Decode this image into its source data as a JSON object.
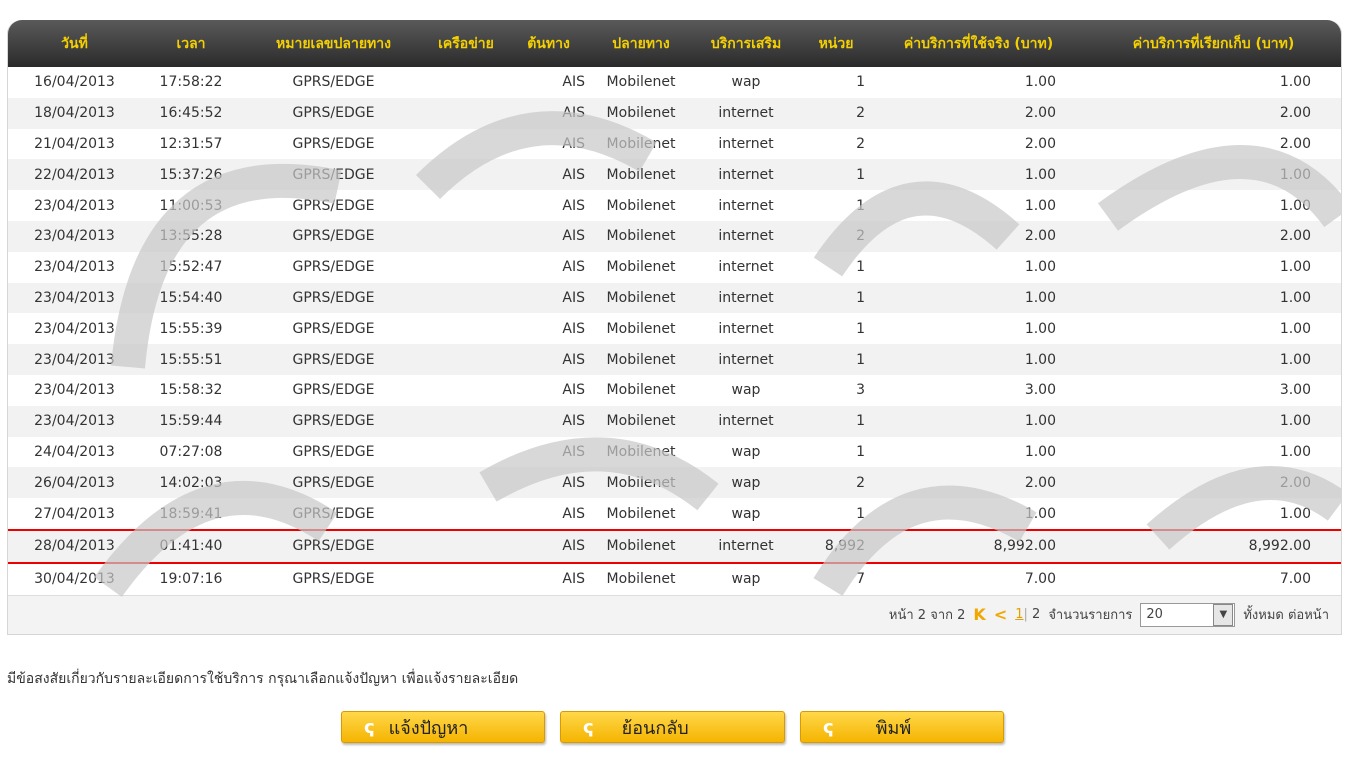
{
  "headers": [
    "วันที่",
    "เวลา",
    "หมายเลขปลายทาง",
    "เครือข่าย",
    "ต้นทาง",
    "ปลายทาง",
    "บริการเสริม",
    "หน่วย",
    "ค่าบริการที่ใช้จริง (บาท)",
    "ค่าบริการที่เรียกเก็บ (บาท)"
  ],
  "rows": [
    [
      "16/04/2013",
      "17:58:22",
      "GPRS/EDGE",
      "",
      "AIS",
      "Mobilenet",
      "wap",
      "1",
      "1.00",
      "1.00"
    ],
    [
      "18/04/2013",
      "16:45:52",
      "GPRS/EDGE",
      "",
      "AIS",
      "Mobilenet",
      "internet",
      "2",
      "2.00",
      "2.00"
    ],
    [
      "21/04/2013",
      "12:31:57",
      "GPRS/EDGE",
      "",
      "AIS",
      "Mobilenet",
      "internet",
      "2",
      "2.00",
      "2.00"
    ],
    [
      "22/04/2013",
      "15:37:26",
      "GPRS/EDGE",
      "",
      "AIS",
      "Mobilenet",
      "internet",
      "1",
      "1.00",
      "1.00"
    ],
    [
      "23/04/2013",
      "11:00:53",
      "GPRS/EDGE",
      "",
      "AIS",
      "Mobilenet",
      "internet",
      "1",
      "1.00",
      "1.00"
    ],
    [
      "23/04/2013",
      "13:55:28",
      "GPRS/EDGE",
      "",
      "AIS",
      "Mobilenet",
      "internet",
      "2",
      "2.00",
      "2.00"
    ],
    [
      "23/04/2013",
      "15:52:47",
      "GPRS/EDGE",
      "",
      "AIS",
      "Mobilenet",
      "internet",
      "1",
      "1.00",
      "1.00"
    ],
    [
      "23/04/2013",
      "15:54:40",
      "GPRS/EDGE",
      "",
      "AIS",
      "Mobilenet",
      "internet",
      "1",
      "1.00",
      "1.00"
    ],
    [
      "23/04/2013",
      "15:55:39",
      "GPRS/EDGE",
      "",
      "AIS",
      "Mobilenet",
      "internet",
      "1",
      "1.00",
      "1.00"
    ],
    [
      "23/04/2013",
      "15:55:51",
      "GPRS/EDGE",
      "",
      "AIS",
      "Mobilenet",
      "internet",
      "1",
      "1.00",
      "1.00"
    ],
    [
      "23/04/2013",
      "15:58:32",
      "GPRS/EDGE",
      "",
      "AIS",
      "Mobilenet",
      "wap",
      "3",
      "3.00",
      "3.00"
    ],
    [
      "23/04/2013",
      "15:59:44",
      "GPRS/EDGE",
      "",
      "AIS",
      "Mobilenet",
      "internet",
      "1",
      "1.00",
      "1.00"
    ],
    [
      "24/04/2013",
      "07:27:08",
      "GPRS/EDGE",
      "",
      "AIS",
      "Mobilenet",
      "wap",
      "1",
      "1.00",
      "1.00"
    ],
    [
      "26/04/2013",
      "14:02:03",
      "GPRS/EDGE",
      "",
      "AIS",
      "Mobilenet",
      "wap",
      "2",
      "2.00",
      "2.00"
    ],
    [
      "27/04/2013",
      "18:59:41",
      "GPRS/EDGE",
      "",
      "AIS",
      "Mobilenet",
      "wap",
      "1",
      "1.00",
      "1.00"
    ],
    [
      "28/04/2013",
      "01:41:40",
      "GPRS/EDGE",
      "",
      "AIS",
      "Mobilenet",
      "internet",
      "8,992",
      "8,992.00",
      "8,992.00"
    ],
    [
      "30/04/2013",
      "19:07:16",
      "GPRS/EDGE",
      "",
      "AIS",
      "Mobilenet",
      "wap",
      "7",
      "7.00",
      "7.00"
    ]
  ],
  "highlighted_row": 15,
  "pager": {
    "page_info": "หน้า 2 จาก 2",
    "first_icon": "K",
    "prev_icon": "<",
    "page1": "1",
    "sep": "|",
    "page2": "2",
    "items_label": "จำนวนรายการ",
    "per_page": "20",
    "suffix": "ทั้งหมด ต่อหน้า"
  },
  "note": "มีข้อสงสัยเกี่ยวกับรายละเอียดการใช้บริการ กรุณาเลือกแจ้งปัญหา เพื่อแจ้งรายละเอียด",
  "buttons": {
    "report": "แจ้งปัญหา",
    "back": "ย้อนกลับ",
    "print": "พิมพ์"
  },
  "colors": {
    "header_text": "#f4d000",
    "highlight": "#ee0000",
    "button": "#f5b400"
  }
}
